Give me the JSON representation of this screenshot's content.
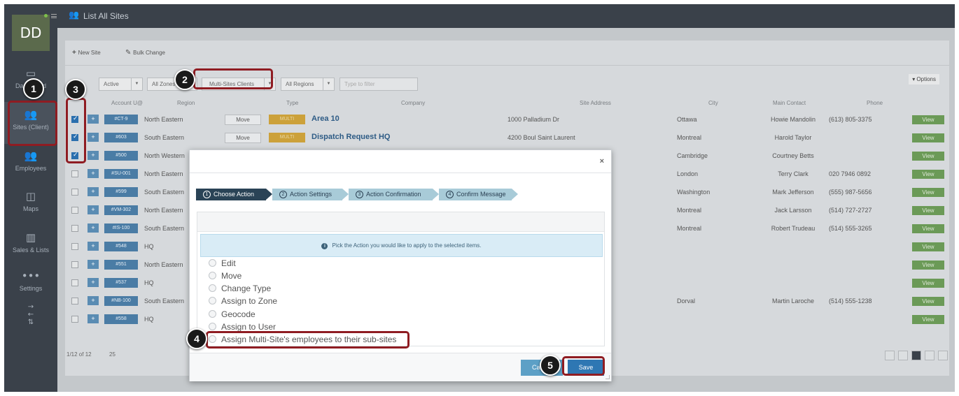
{
  "sidebar": {
    "avatar_initials": "DD",
    "items": [
      {
        "label": "Dashboard",
        "icon": "monitor-icon"
      },
      {
        "label": "Sites (Client)",
        "icon": "people-icon"
      },
      {
        "label": "Employees",
        "icon": "people-icon"
      },
      {
        "label": "Maps",
        "icon": "map-icon"
      },
      {
        "label": "Sales & Lists",
        "icon": "bar-chart-icon"
      },
      {
        "label": "Settings",
        "icon": "dots-icon"
      }
    ]
  },
  "header": {
    "title": "List All Sites"
  },
  "toolbar": {
    "new_site": "New Site",
    "bulk_change": "Bulk Change",
    "options": "▾ Options"
  },
  "filters": {
    "status": "Active",
    "zone": "All Zones",
    "client_type": "Multi-Sites Clients",
    "region": "All Regions",
    "search_placeholder": "Type to filter"
  },
  "table": {
    "headers": [
      "Account U@",
      "Region",
      "Type",
      "Company",
      "Site Address",
      "City",
      "Main Contact",
      "Phone"
    ],
    "move_label": "Move",
    "multi_label": "MULTI",
    "view_label": "View",
    "rows": [
      {
        "checked": true,
        "account": "#CT-9",
        "region": "North Eastern",
        "has_move": true,
        "is_multi": true,
        "company": "Area 10",
        "address": "1000 Palladium Dr",
        "city": "Ottawa",
        "contact": "Howie Mandolin",
        "phone": "(613) 805-3375"
      },
      {
        "checked": true,
        "account": "#603",
        "region": "South Eastern",
        "has_move": true,
        "is_multi": true,
        "company": "Dispatch Request HQ",
        "address": "4200 Boul Saint Laurent",
        "city": "Montreal",
        "contact": "Harold Taylor",
        "phone": ""
      },
      {
        "checked": true,
        "account": "#500",
        "region": "North Western",
        "has_move": false,
        "is_multi": false,
        "company": "",
        "address": "",
        "city": "Cambridge",
        "contact": "Courtney Betts",
        "phone": ""
      },
      {
        "checked": false,
        "account": "#SU-001",
        "region": "North Eastern",
        "has_move": false,
        "is_multi": false,
        "company": "",
        "address": "",
        "city": "London",
        "contact": "Terry Clark",
        "phone": "020 7946 0892"
      },
      {
        "checked": false,
        "account": "#599",
        "region": "South Eastern",
        "has_move": false,
        "is_multi": false,
        "company": "",
        "address": "",
        "city": "Washington",
        "contact": "Mark Jefferson",
        "phone": "(555) 987-5656"
      },
      {
        "checked": false,
        "account": "#VM-302",
        "region": "North Eastern",
        "has_move": false,
        "is_multi": false,
        "company": "",
        "address": "",
        "city": "Montreal",
        "contact": "Jack Larsson",
        "phone": "(514) 727-2727"
      },
      {
        "checked": false,
        "account": "#IS-100",
        "region": "South Eastern",
        "has_move": false,
        "is_multi": false,
        "company": "",
        "address": "",
        "city": "Montreal",
        "contact": "Robert Trudeau",
        "phone": "(514) 555-3265"
      },
      {
        "checked": false,
        "account": "#548",
        "region": "HQ",
        "has_move": false,
        "is_multi": false,
        "company": "",
        "address": "",
        "city": "",
        "contact": "",
        "phone": ""
      },
      {
        "checked": false,
        "account": "#551",
        "region": "North Eastern",
        "has_move": false,
        "is_multi": false,
        "company": "",
        "address": "",
        "city": "",
        "contact": "",
        "phone": ""
      },
      {
        "checked": false,
        "account": "#537",
        "region": "HQ",
        "has_move": false,
        "is_multi": false,
        "company": "",
        "address": "",
        "city": "",
        "contact": "",
        "phone": ""
      },
      {
        "checked": false,
        "account": "#NB-100",
        "region": "South Eastern",
        "has_move": false,
        "is_multi": false,
        "company": "",
        "address": "",
        "city": "Dorval",
        "contact": "Martin Laroche",
        "phone": "(514) 555-1238"
      },
      {
        "checked": false,
        "account": "#558",
        "region": "HQ",
        "has_move": false,
        "is_multi": false,
        "company": "",
        "address": "",
        "city": "",
        "contact": "",
        "phone": ""
      }
    ]
  },
  "pagination": {
    "summary": "1/12 of 12",
    "page_size": "25"
  },
  "modal": {
    "close": "×",
    "steps": [
      {
        "num": "1",
        "label": "Choose Action"
      },
      {
        "num": "2",
        "label": "Action Settings"
      },
      {
        "num": "3",
        "label": "Action Confirmation"
      },
      {
        "num": "4",
        "label": "Confirm Message"
      }
    ],
    "info_text": "Pick the Action you would like to apply to the selected items.",
    "info_icon": "i",
    "options": [
      "Edit",
      "Move",
      "Change Type",
      "Assign to Zone",
      "Geocode",
      "Assign to User",
      "Assign Multi-Site's employees to their sub-sites"
    ],
    "cancel_label": "Cancel",
    "save_label": "Save"
  },
  "annotations": {
    "markers": [
      "1",
      "2",
      "3",
      "4",
      "5"
    ],
    "highlight_color": "#8f1c22"
  }
}
